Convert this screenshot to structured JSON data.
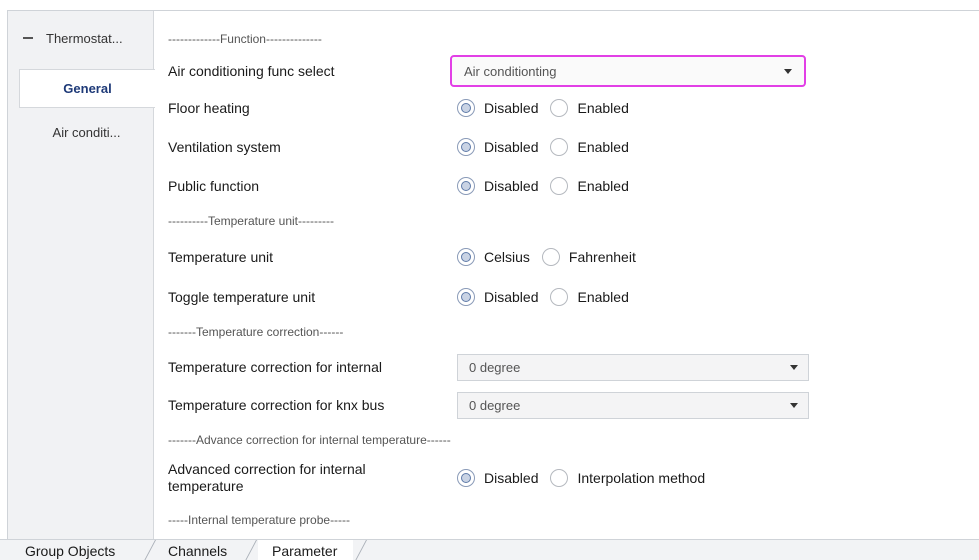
{
  "sidebar": {
    "tree_root": "Thermostat...",
    "items": [
      {
        "label": "General",
        "active": true
      },
      {
        "label": "Air conditi...",
        "active": false
      }
    ]
  },
  "params": {
    "section_function": "-------------Function--------------",
    "air_cond_func": {
      "label": "Air conditioning func select",
      "value": "Air conditionting"
    },
    "floor_heating": {
      "label": "Floor heating",
      "options": [
        "Disabled",
        "Enabled"
      ],
      "selected": "Disabled"
    },
    "ventilation": {
      "label": "Ventilation system",
      "options": [
        "Disabled",
        "Enabled"
      ],
      "selected": "Disabled"
    },
    "public_function": {
      "label": "Public function",
      "options": [
        "Disabled",
        "Enabled"
      ],
      "selected": "Disabled"
    },
    "section_temp_unit": "----------Temperature unit---------",
    "temp_unit": {
      "label": "Temperature unit",
      "options": [
        "Celsius",
        "Fahrenheit"
      ],
      "selected": "Celsius"
    },
    "toggle_temp_unit": {
      "label": "Toggle temperature unit",
      "options": [
        "Disabled",
        "Enabled"
      ],
      "selected": "Disabled"
    },
    "section_temp_correction": "-------Temperature correction------",
    "corr_internal": {
      "label": "Temperature correction for internal",
      "value": "0 degree"
    },
    "corr_knx": {
      "label": "Temperature correction for knx bus",
      "value": "0 degree"
    },
    "section_advance": "-------Advance correction for internal temperature------",
    "advanced_corr": {
      "label_line1": "Advanced correction for internal",
      "label_line2": "temperature",
      "options": [
        "Disabled",
        "Interpolation method"
      ],
      "selected": "Disabled"
    },
    "section_probe": "-----Internal temperature probe-----"
  },
  "tabs": [
    {
      "label": "Group Objects",
      "active": false
    },
    {
      "label": "Channels",
      "active": false
    },
    {
      "label": "Parameter",
      "active": true
    }
  ],
  "colors": {
    "highlight_border": "#e23fe6",
    "active_tree_text": "#1e3a78"
  }
}
